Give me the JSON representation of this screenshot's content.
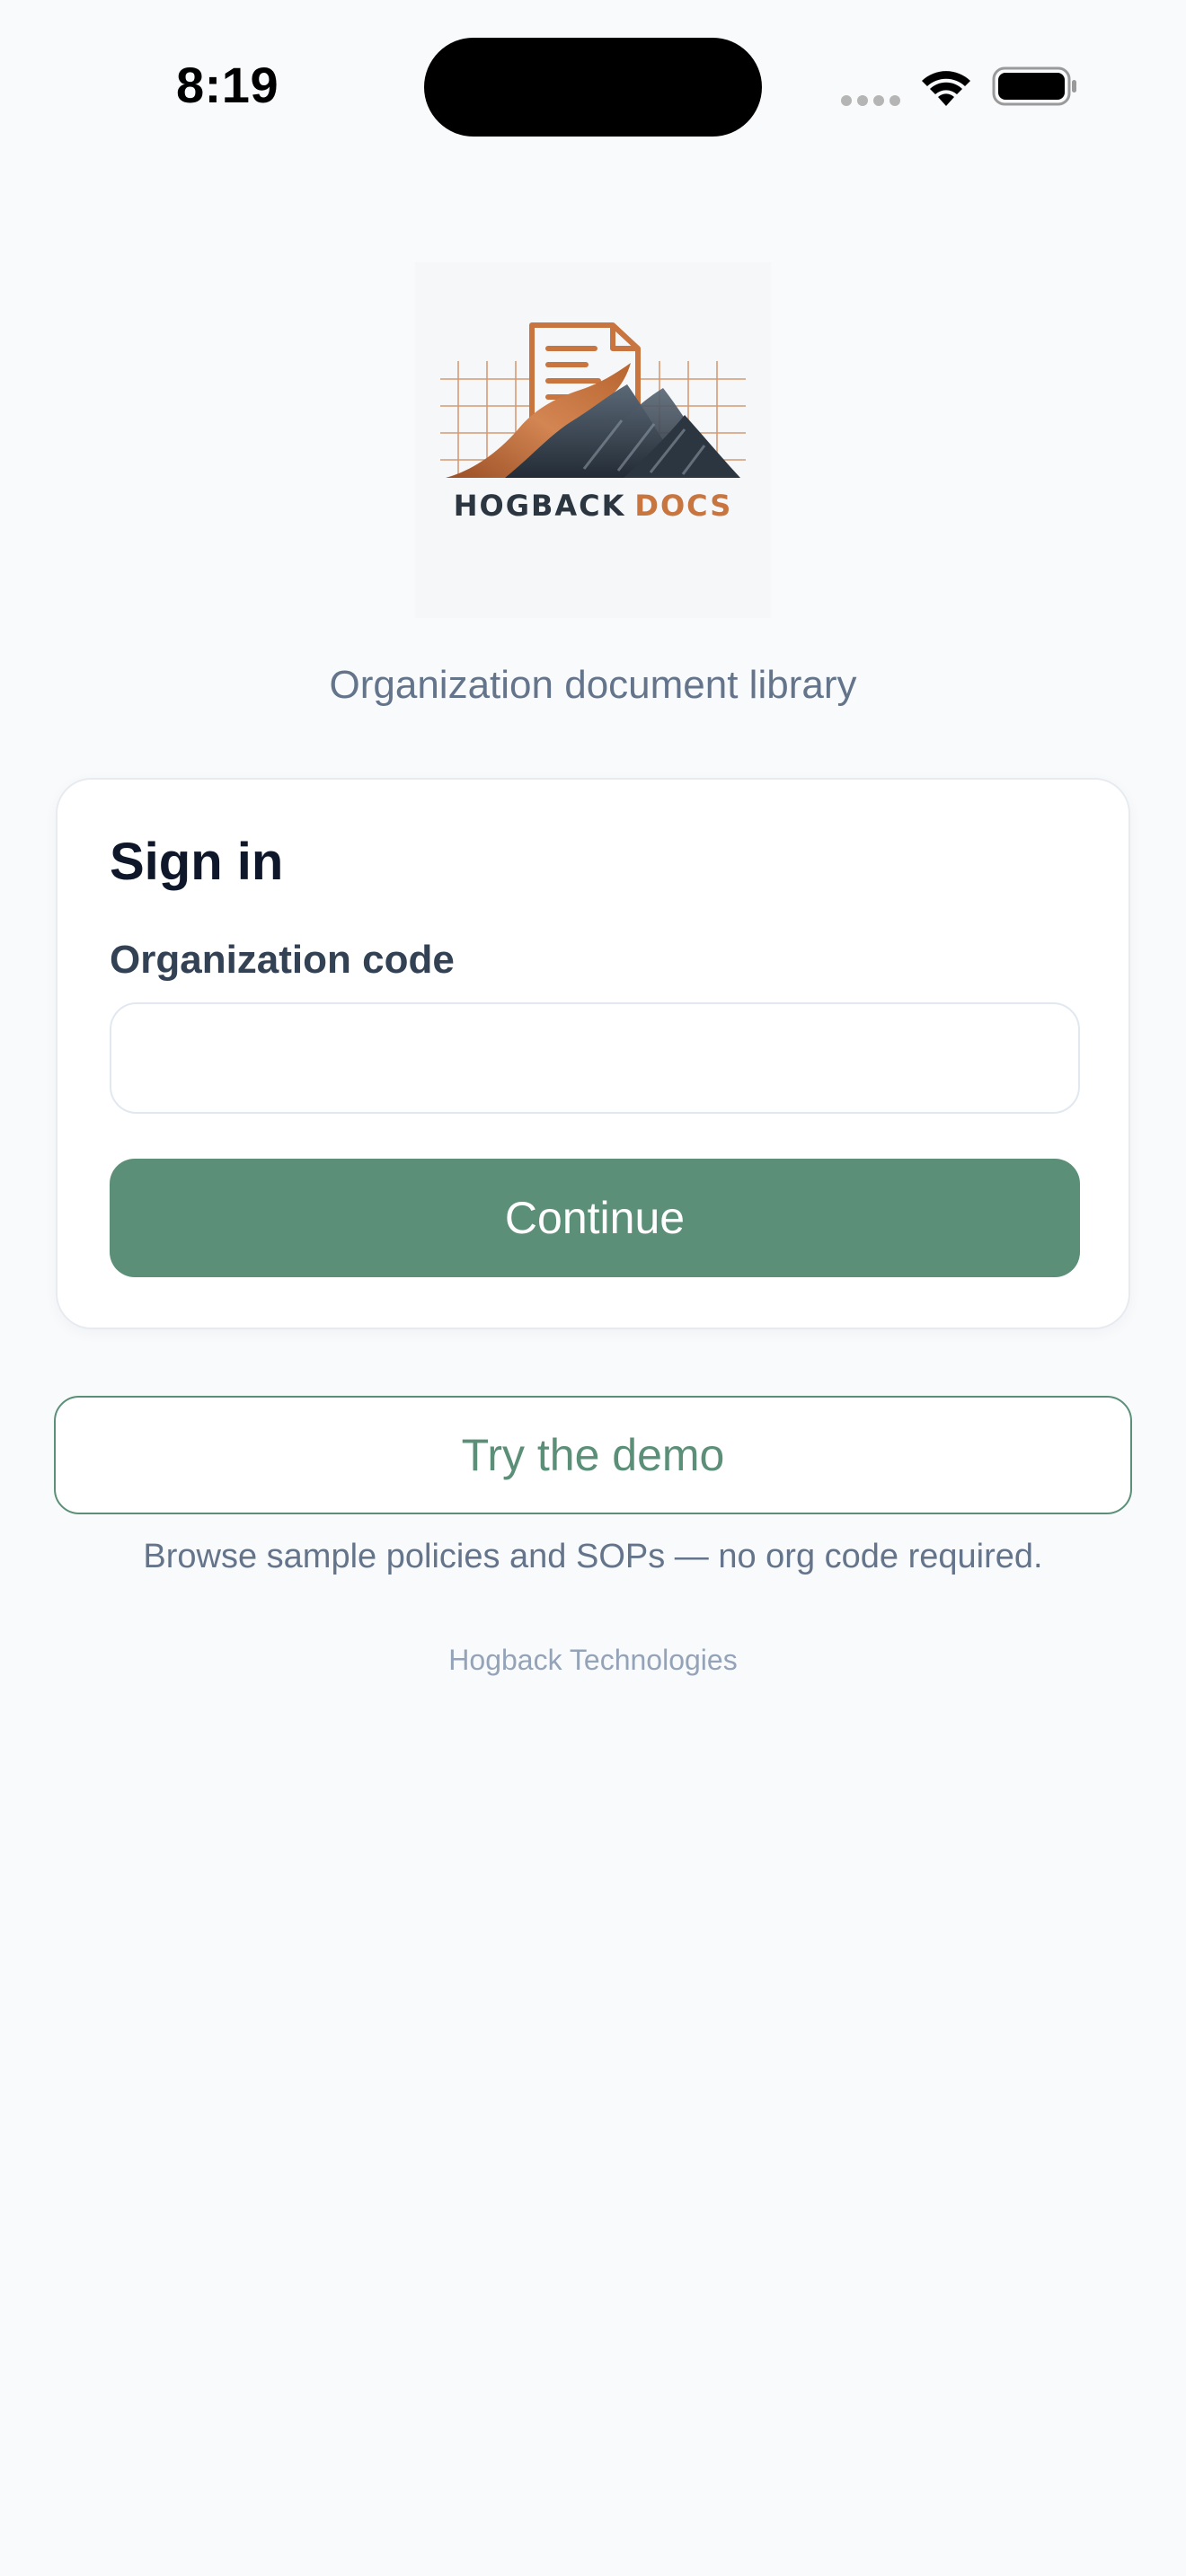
{
  "status_bar": {
    "time": "8:19",
    "signal_icon": "cellular-dots-icon",
    "wifi_icon": "wifi-icon",
    "battery_icon": "battery-icon",
    "battery_level": 1.0
  },
  "logo": {
    "wordmark_primary": "HOGBACK",
    "wordmark_secondary": "DOCS",
    "colors": {
      "copper": "#c8753f",
      "slate": "#2c3641"
    }
  },
  "tagline": "Organization document library",
  "sign_in": {
    "title": "Sign in",
    "org_code_label": "Organization code",
    "org_code_value": "",
    "org_code_placeholder": "",
    "continue_label": "Continue"
  },
  "demo": {
    "button_label": "Try the demo",
    "hint": "Browse sample policies and SOPs — no org code required."
  },
  "footer": "Hogback Technologies",
  "colors": {
    "accent": "#5b8f78",
    "background": "#f8fafc",
    "muted_text": "#64748b"
  }
}
